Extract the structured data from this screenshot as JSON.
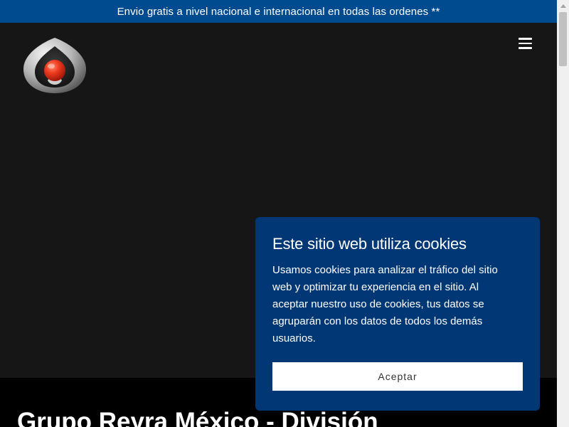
{
  "announcement": {
    "text": "Envio gratis a nivel nacional e internacional en todas las ordenes **"
  },
  "header": {
    "logo_icon": "drop-orb-logo-icon",
    "menu_icon": "hamburger-menu-icon"
  },
  "hero": {
    "title": "Grupo Reyra México - División"
  },
  "cookie_banner": {
    "title": "Este sitio web utiliza cookies",
    "body": "Usamos cookies para analizar el tráfico del sitio web y optimizar tu experiencia en el sitio. Al aceptar nuestro uso de cookies, tus datos se agruparán con los datos de todos los demás usuarios.",
    "accept_label": "Aceptar"
  },
  "colors": {
    "announcement_bg": "#004a8f",
    "header_bg": "#161616",
    "cookie_bg": "#003774",
    "logo_orb": "#e8351f"
  }
}
